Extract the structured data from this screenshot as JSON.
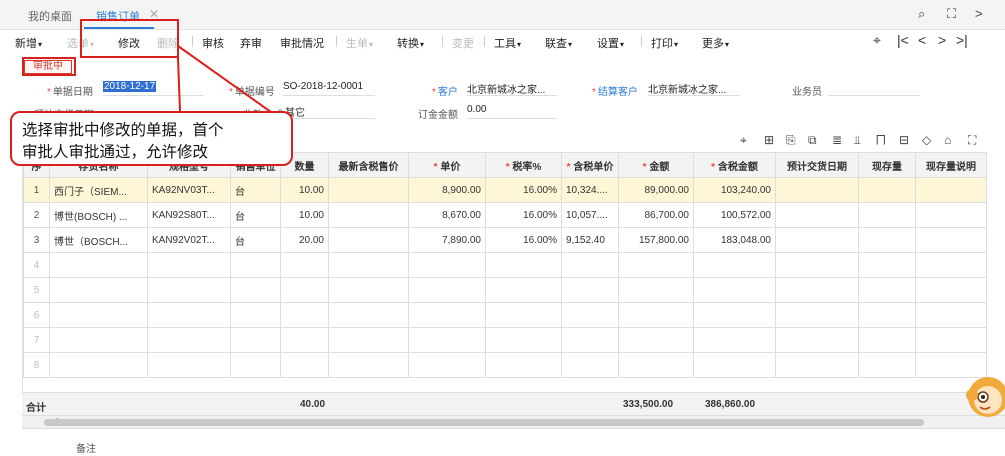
{
  "tabs": {
    "home": "我的桌面",
    "active": "销售订单",
    "close": "✕"
  },
  "window_icons": [
    "search-icon",
    "maximize-icon",
    "next-icon"
  ],
  "toolbar": {
    "new": "新增",
    "select": "选单",
    "edit": "修改",
    "delete": "删除",
    "audit": "审核",
    "abandon": "弃审",
    "approval_status": "审批情况",
    "generate": "生单",
    "convert": "转换",
    "change": "变更",
    "tools": "工具",
    "link_query": "联查",
    "settings": "设置",
    "print": "打印",
    "more": "更多"
  },
  "status_badge": "审批中",
  "form": {
    "date_label": "单据日期",
    "date_value": "2018-12-17",
    "code_label": "单据编号",
    "code_value": "SO-2018-12-0001",
    "customer_label": "客户",
    "customer_value": "北京新城冰之家...",
    "settle_label": "结算客户",
    "settle_value": "北京新城冰之家...",
    "salesman_label": "业务员",
    "salesman_value": "",
    "delivery_label": "预计交货日期",
    "type_label": "收款方式",
    "type_value": "其它",
    "deposit_label": "订金金额",
    "deposit_value": "0.00"
  },
  "callout": {
    "line1": "选择审批中修改的单据，首个",
    "line2": "审批人审批通过，允许修改"
  },
  "grid": {
    "headers": [
      "序",
      "存货名称",
      "规格型号",
      "销售单位",
      "数量",
      "最新含税售价",
      "单价",
      "税率%",
      "含税单价",
      "金额",
      "含税金额",
      "预计交货日期",
      "现存量",
      "现存量说明"
    ],
    "rows": [
      {
        "no": "1",
        "name": "西门子（SIEM...",
        "spec": "KA92NV03T...",
        "unit": "台",
        "qty": "10.00",
        "latest": "",
        "price": "8,900.00",
        "tax": "16.00%",
        "taxprice": "10,324....",
        "amount": "89,000.00",
        "taxamount": "103,240.00",
        "date": "",
        "stock": "",
        "note": ""
      },
      {
        "no": "2",
        "name": "博世(BOSCH) ...",
        "spec": "KAN92S80T...",
        "unit": "台",
        "qty": "10.00",
        "latest": "",
        "price": "8,670.00",
        "tax": "16.00%",
        "taxprice": "10,057....",
        "amount": "86,700.00",
        "taxamount": "100,572.00",
        "date": "",
        "stock": "",
        "note": ""
      },
      {
        "no": "3",
        "name": "博世（BOSCH...",
        "spec": "KAN92V02T...",
        "unit": "台",
        "qty": "20.00",
        "latest": "",
        "price": "7,890.00",
        "tax": "16.00%",
        "taxprice": "9,152.40",
        "amount": "157,800.00",
        "taxamount": "183,048.00",
        "date": "",
        "stock": "",
        "note": ""
      }
    ],
    "empty_rows": [
      "4",
      "5",
      "6",
      "7",
      "8"
    ]
  },
  "summary": {
    "label": "合计",
    "qty": "40.00",
    "amount": "333,500.00",
    "taxamount": "386,860.00"
  },
  "remark_label": "备注",
  "colors": {
    "accent": "#2e7bd6",
    "highlight_red": "#d9201c",
    "row_highlight": "#fdf6d7"
  }
}
